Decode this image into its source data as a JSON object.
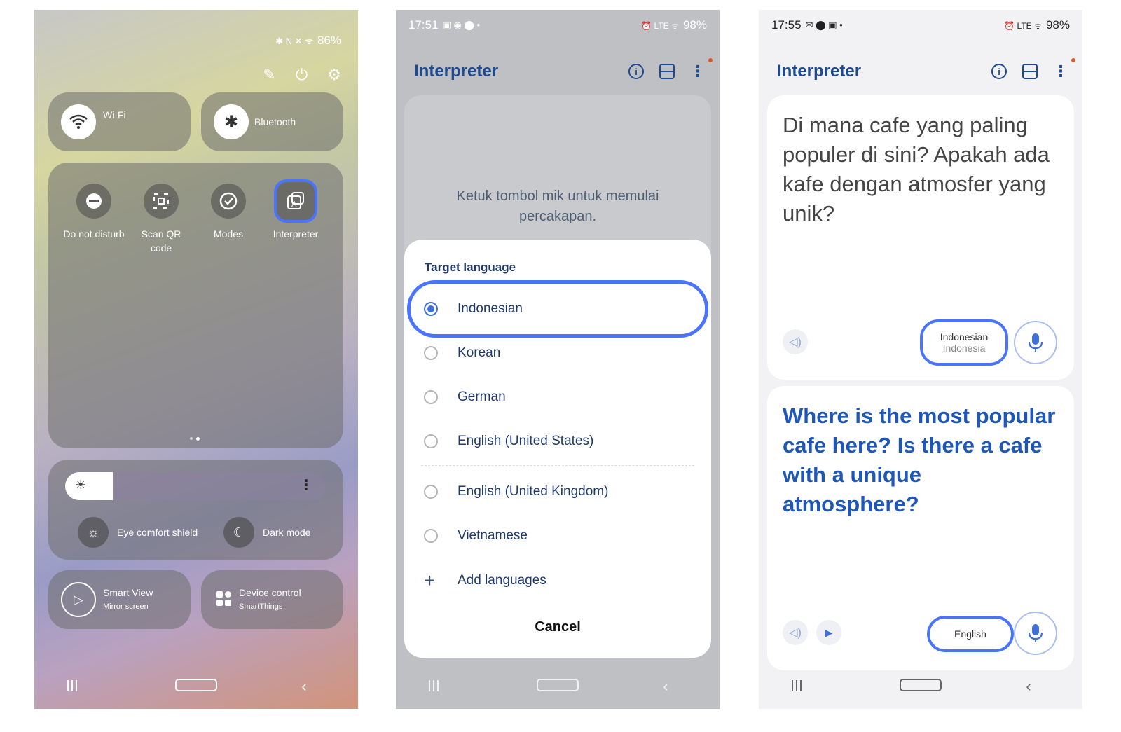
{
  "panel1": {
    "status": {
      "battery": "86%"
    },
    "tiles": {
      "wifi_label": "Wi-Fi",
      "bluetooth_label": "Bluetooth"
    },
    "grid": [
      {
        "label": "Do not disturb"
      },
      {
        "label": "Scan QR code"
      },
      {
        "label": "Modes"
      },
      {
        "label": "Interpreter"
      }
    ],
    "eye_comfort": "Eye comfort shield",
    "dark_mode": "Dark mode",
    "smart_view": {
      "title": "Smart View",
      "sub": "Mirror screen"
    },
    "device_control": {
      "title": "Device control",
      "sub": "SmartThings"
    }
  },
  "panel2": {
    "status": {
      "time": "17:51",
      "battery": "98%"
    },
    "app_title": "Interpreter",
    "hint": "Ketuk tombol mik untuk memulai percakapan.",
    "dialog": {
      "title": "Target language",
      "options": [
        {
          "label": "Indonesian"
        },
        {
          "label": "Korean"
        },
        {
          "label": "German"
        },
        {
          "label": "English (United States)"
        },
        {
          "label": "English (United Kingdom)"
        },
        {
          "label": "Vietnamese"
        }
      ],
      "add": "Add languages",
      "cancel": "Cancel"
    },
    "accent": "#4a74ff"
  },
  "panel3": {
    "status": {
      "time": "17:55",
      "battery": "98%"
    },
    "app_title": "Interpreter",
    "source_text": "Di mana cafe yang paling populer di sini? Apakah ada kafe dengan atmosfer yang unik?",
    "source_lang": {
      "line1": "Indonesian",
      "line2": "Indonesia"
    },
    "target_text": "Where is the most popular cafe here? Is there a cafe with a unique atmosphere?",
    "target_lang": "English"
  }
}
